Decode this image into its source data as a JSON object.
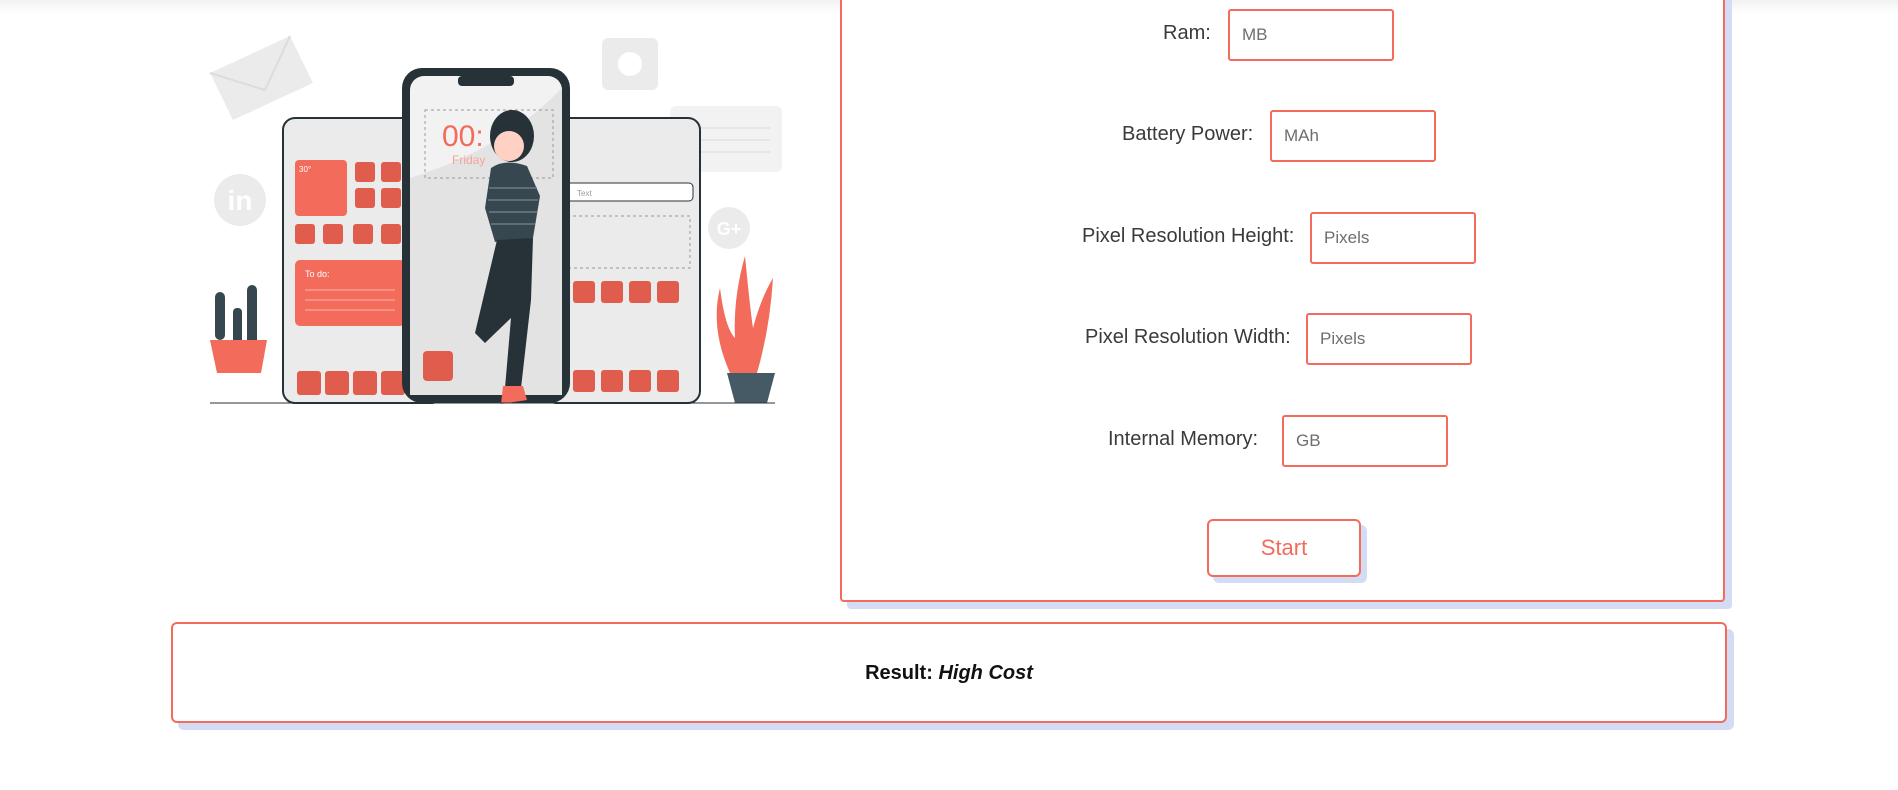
{
  "form": {
    "fields": [
      {
        "label": "Ram:",
        "placeholder": "MB"
      },
      {
        "label": "Battery Power:",
        "placeholder": "MAh"
      },
      {
        "label": "Pixel Resolution Height:",
        "placeholder": "Pixels"
      },
      {
        "label": "Pixel Resolution Width:",
        "placeholder": "Pixels"
      },
      {
        "label": "Internal Memory:",
        "placeholder": "GB"
      }
    ],
    "start_label": "Start"
  },
  "result": {
    "label": "Result:",
    "value": "High Cost"
  },
  "illustration": {
    "clock_text": "00:",
    "day_text": "Friday",
    "weather_text": "30°",
    "todo_text": "To do:",
    "search_text": "Text"
  },
  "colors": {
    "accent": "#f26b5b",
    "shadow": "#d4dcf3",
    "dark": "#263238",
    "light_gray": "#ebebeb"
  }
}
